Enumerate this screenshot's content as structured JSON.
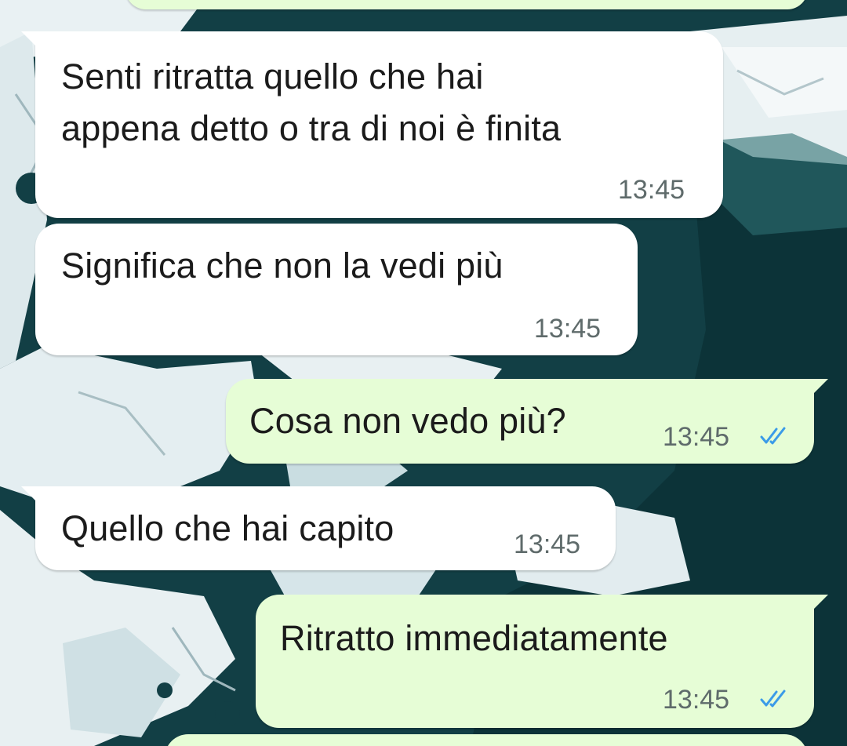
{
  "chat": {
    "messages": [
      {
        "direction": "incoming",
        "line1": "Senti ritratta quello che hai",
        "line2": "appena detto o tra di noi è finita",
        "time": "13:45"
      },
      {
        "direction": "incoming",
        "text": "Significa che non la vedi più",
        "time": "13:45"
      },
      {
        "direction": "outgoing",
        "text": "Cosa non vedo più?",
        "time": "13:45",
        "status": "read",
        "status_icon": "double-check-icon"
      },
      {
        "direction": "incoming",
        "text": "Quello che hai capito",
        "time": "13:45"
      },
      {
        "direction": "outgoing",
        "text": "Ritratto immediatamente",
        "time": "13:45",
        "status": "read",
        "status_icon": "double-check-icon"
      }
    ]
  },
  "colors": {
    "incoming_bubble": "#ffffff",
    "outgoing_bubble": "#e6fdd6",
    "read_ticks": "#3b9be8",
    "timestamp": "#5f6b6b",
    "wallpaper_water": "#0f3f44"
  }
}
